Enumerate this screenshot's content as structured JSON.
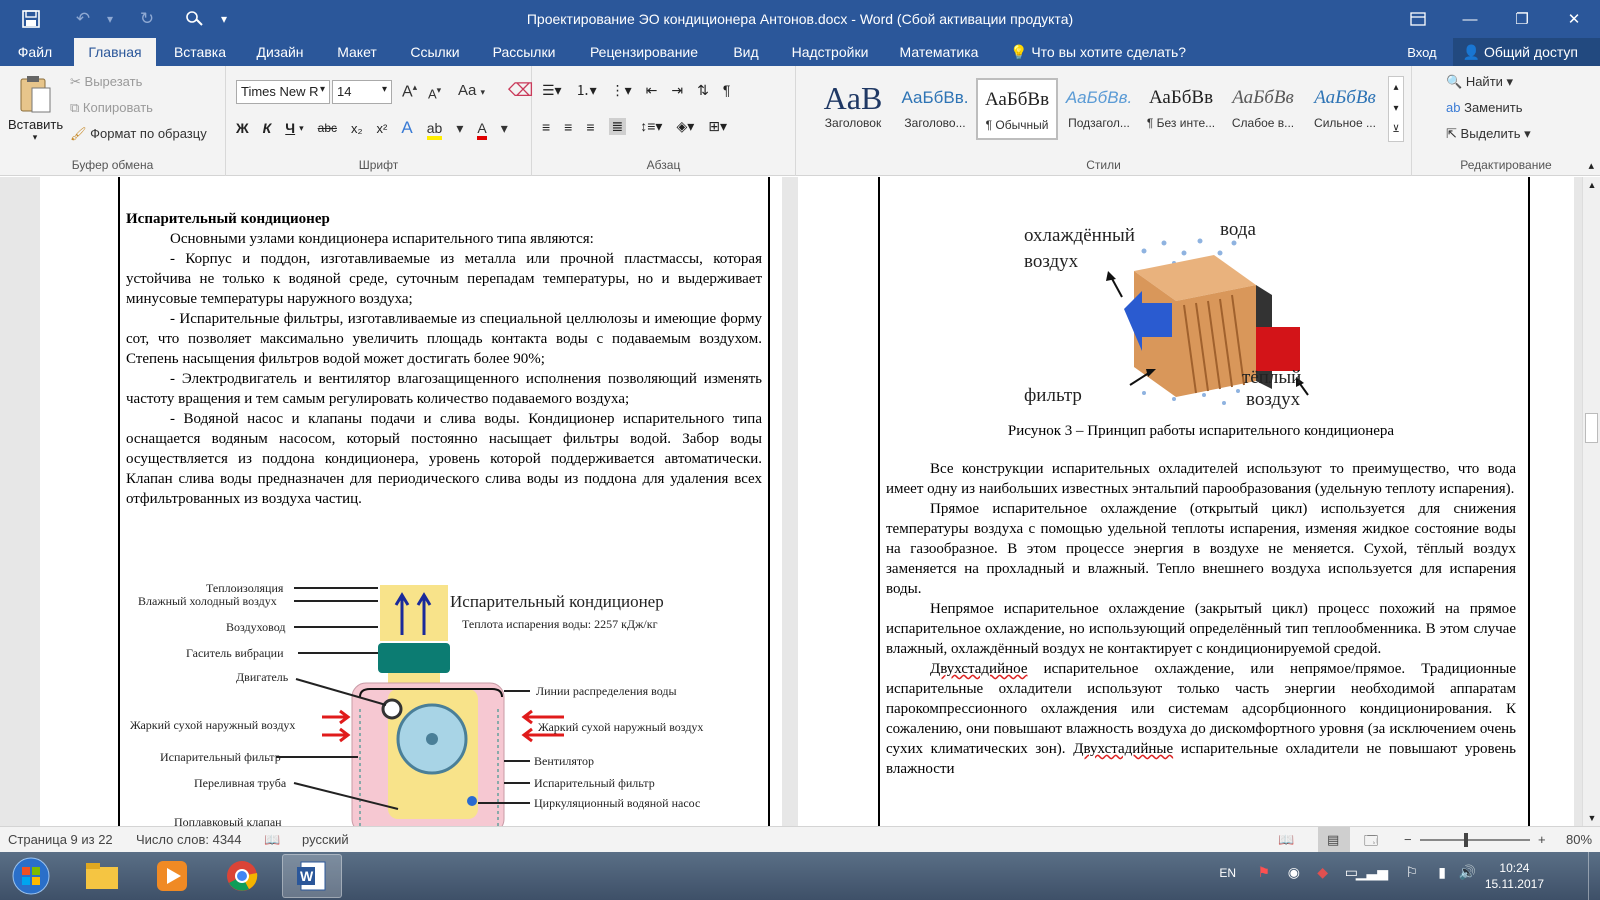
{
  "window": {
    "title": "Проектирование ЭО кондиционера Антонов.docx - Word (Сбой активации продукта)"
  },
  "ribbon_tabs": [
    {
      "label": "Файл",
      "active": false
    },
    {
      "label": "Главная",
      "active": true
    },
    {
      "label": "Вставка",
      "active": false
    },
    {
      "label": "Дизайн",
      "active": false
    },
    {
      "label": "Макет",
      "active": false
    },
    {
      "label": "Ссылки",
      "active": false
    },
    {
      "label": "Рассылки",
      "active": false
    },
    {
      "label": "Рецензирование",
      "active": false
    },
    {
      "label": "Вид",
      "active": false
    },
    {
      "label": "Надстройки",
      "active": false
    },
    {
      "label": "Математика",
      "active": false
    }
  ],
  "tell_me": "Что вы хотите сделать?",
  "account": {
    "signin": "Вход",
    "share": "Общий доступ"
  },
  "clipboard": {
    "paste": "Вставить",
    "cut": "Вырезать",
    "copy": "Копировать",
    "format_painter": "Формат по образцу",
    "label": "Буфер обмена"
  },
  "font": {
    "name": "Times New R",
    "size": "14",
    "label": "Шрифт",
    "case_label": "Aa",
    "bold": "Ж",
    "italic": "К",
    "underline": "Ч",
    "strike": "abc",
    "sub": "x₂",
    "sup": "x²",
    "grow": "A",
    "shrink": "A"
  },
  "paragraph": {
    "label": "Абзац"
  },
  "styles": {
    "label": "Стили",
    "items": [
      {
        "sample": "AaB",
        "name": "Заголовок",
        "color": "#1f3864"
      },
      {
        "sample": "АаБбВв.",
        "name": "Заголово...",
        "color": "#2e74b5"
      },
      {
        "sample": "АаБбВв",
        "name": "¶ Обычный",
        "color": "#000000"
      },
      {
        "sample": "АаБбВв.",
        "name": "Подзагол...",
        "color": "#5b9bd5"
      },
      {
        "sample": "АаБбВв",
        "name": "¶ Без инте...",
        "color": "#000000"
      },
      {
        "sample": "АаБбВв",
        "name": "Слабое в...",
        "color": "#595959"
      },
      {
        "sample": "АаБбВв",
        "name": "Сильное ...",
        "color": "#2e74b5"
      }
    ]
  },
  "editing": {
    "label": "Редактирование",
    "find": "Найти",
    "replace": "Заменить",
    "select": "Выделить"
  },
  "left_page": {
    "heading": "Испарительный кондиционер",
    "paragraphs": [
      "Основными узлами кондиционера испарительного типа являются:",
      "- Корпус и поддон, изготавливаемые из металла или прочной пластмассы, которая устойчива не только к водяной среде, суточным перепадам температуры, но и выдерживает минусовые температуры наружного воздуха;",
      "- Испарительные фильтры, изготавливаемые из специальной целлюлозы и имеющие форму сот, что позволяет максимально увеличить площадь контакта воды с подаваемым воздухом. Степень насыщения фильтров водой может достигать более 90%;",
      "- Электродвигатель и вентилятор влагозащищенного исполнения позволяющий изменять частоту вращения и тем самым регулировать количество подаваемого воздуха;",
      "- Водяной насос и клапаны подачи и слива воды. Кондиционер испарительного типа оснащается водяным насосом, который постоянно насыщает фильтры водой. Забор воды осуществляется из поддона кондиционера, уровень которой поддерживается автоматически. Клапан слива воды предназначен для периодического слива воды из поддона для удаления всех отфильтрованных из воздуха частиц."
    ],
    "diagram": {
      "title": "Испарительный кондиционер",
      "subtitle": "Теплота испарения воды: 2257 кДж/кг",
      "left_labels": [
        "Теплоизоляция",
        "Влажный холодный воздух",
        "Воздуховод",
        "Гаситель вибрации",
        "Двигатель",
        "Жаркий сухой наружный воздух",
        "Испарительный фильтр",
        "Переливная труба",
        "Поплавковый клапан"
      ],
      "right_labels": [
        "Линии распределения воды",
        "Жаркий сухой наружный воздух",
        "Вентилятор",
        "Испарительный фильтр",
        "Циркуляционный водяной насос"
      ]
    }
  },
  "right_page": {
    "figure_labels": {
      "cooled_air": "охлаждённый воздух",
      "water": "вода",
      "warm_air": "тёплый воздух",
      "filter": "фильтр"
    },
    "caption": "Рисунок 3 – Принцип работы испарительного кондиционера",
    "p1": "Все конструкции испарительных охладителей используют то преимущество, что вода имеет одну из наибольших известных энтальпий парообразования (удельную теплоту испарения).",
    "p2": "Прямое испарительное охлаждение (открытый цикл) используется для снижения температуры воздуха с помощью удельной теплоты испарения, изменяя жидкое состояние воды на газообразное. В этом процессе энергия в воздухе не меняется. Сухой, тёплый воздух заменяется на прохладный и влажный. Тепло внешнего воздуха используется для испарения воды.",
    "p3": "Непрямое испарительное охлаждение (закрытый цикл) процесс похожий на прямое испарительное охлаждение, но использующий определённый тип теплообменника. В этом случае влажный, охлаждённый воздух не контактирует с кондиционируемой средой.",
    "p4_word": "Двухстадийное",
    "p4_rest": " испарительное охлаждение, или непрямое/прямое. Традиционные испарительные охладители используют только часть энергии необходимой аппаратам парокомпрессионного охлаждения или системам адсорбционного кондиционирования. К сожалению, они повышают влажность воздуха до дискомфортного уровня (за исключением очень сухих климатических зон).",
    "p5_word": "Двухстадийные",
    "p5_rest": " испарительные охладители не повышают уровень влажности"
  },
  "status": {
    "page": "Страница 9 из 22",
    "words": "Число слов: 4344",
    "language": "русский",
    "zoom": "80%"
  },
  "taskbar": {
    "lang": "EN",
    "time": "10:24",
    "date": "15.11.2017"
  }
}
